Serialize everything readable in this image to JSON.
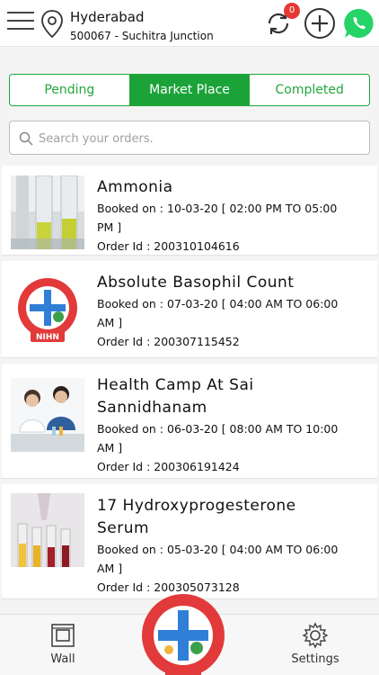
{
  "header": {
    "city": "Hyderabad",
    "area": "500067 - Suchitra Junction",
    "notification_count": "0"
  },
  "tabs": [
    {
      "label": "Pending"
    },
    {
      "label": "Market Place"
    },
    {
      "label": "Completed"
    }
  ],
  "search": {
    "placeholder": "Search your orders."
  },
  "orders": [
    {
      "title": "Ammonia",
      "booked": "Booked on : 10-03-20 [ 02:00 PM TO 05:00 PM ]",
      "order_id": "Order Id : 200310104616",
      "thumb": "test-tubes-photo"
    },
    {
      "title": "Absolute Basophil Count",
      "booked": "Booked on : 07-03-20 [ 04:00 AM TO 06:00 AM ]",
      "order_id": "Order Id : 200307115452",
      "thumb": "nihn-logo"
    },
    {
      "title": "Health Camp At Sai Sannidhanam",
      "booked": "Booked on : 06-03-20 [ 08:00 AM TO 10:00 AM ]",
      "order_id": "Order Id : 200306191424",
      "thumb": "doctors-photo"
    },
    {
      "title": "17 Hydroxyprogesterone Serum",
      "booked": "Booked on : 05-03-20 [ 04:00 AM TO 06:00 AM ]",
      "order_id": "Order Id : 200305073128",
      "thumb": "lab-sample-photo"
    }
  ],
  "bottom_nav": {
    "wall_label": "Wall",
    "settings_label": "Settings"
  },
  "logo": {
    "text": "National Integrated Healthcare Network",
    "short": "NIHN"
  },
  "colors": {
    "accent": "#1ba33a",
    "badge": "#e53935",
    "whatsapp": "#25d366"
  }
}
